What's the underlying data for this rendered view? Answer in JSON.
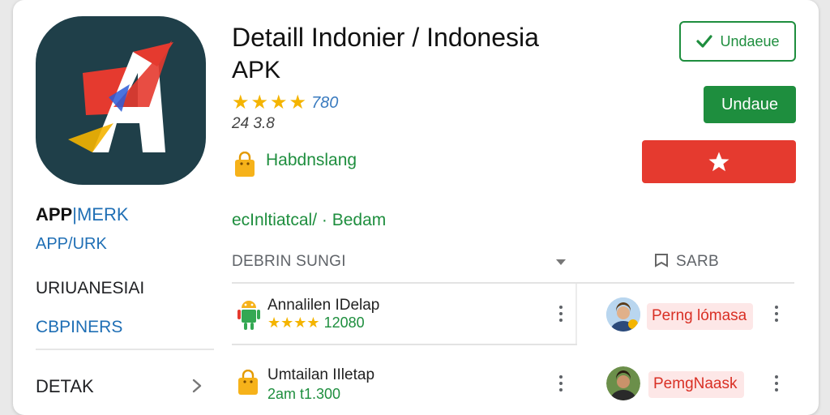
{
  "app": {
    "title": "Detaill Indonier / Indonesia",
    "title_line2": "APK",
    "rating_count": "780",
    "rating_sub": "24 3.8",
    "category": "Habdnslang",
    "tagline": "ecInltiatcal/ · Bedam",
    "icon": "app-logo-icon"
  },
  "nav": {
    "brand_a": "APP",
    "brand_sep": "|",
    "brand_b": "MERK",
    "link1": "APP/URK",
    "item1": "URIUANESIAI",
    "link2": "CBPINERS",
    "item2": "DETAK"
  },
  "actions": {
    "outline_label": "Undaeue",
    "green_label": "Undaue"
  },
  "list": {
    "header": "DEBRIN SUNGI",
    "side_header": "SARB",
    "rows": [
      {
        "title": "Annalilen IDelap",
        "stars": "★★★★",
        "sub": "12080",
        "tag": "Perng lómasa"
      },
      {
        "title": "Umtailan IIletap",
        "stars": "",
        "sub": "2am t1.300",
        "tag": "PemgNaask"
      }
    ]
  },
  "colors": {
    "accent_green": "#1e8e3e",
    "accent_red": "#e53a2f",
    "link_blue": "#1f6fb5",
    "star_yellow": "#f4b400"
  }
}
